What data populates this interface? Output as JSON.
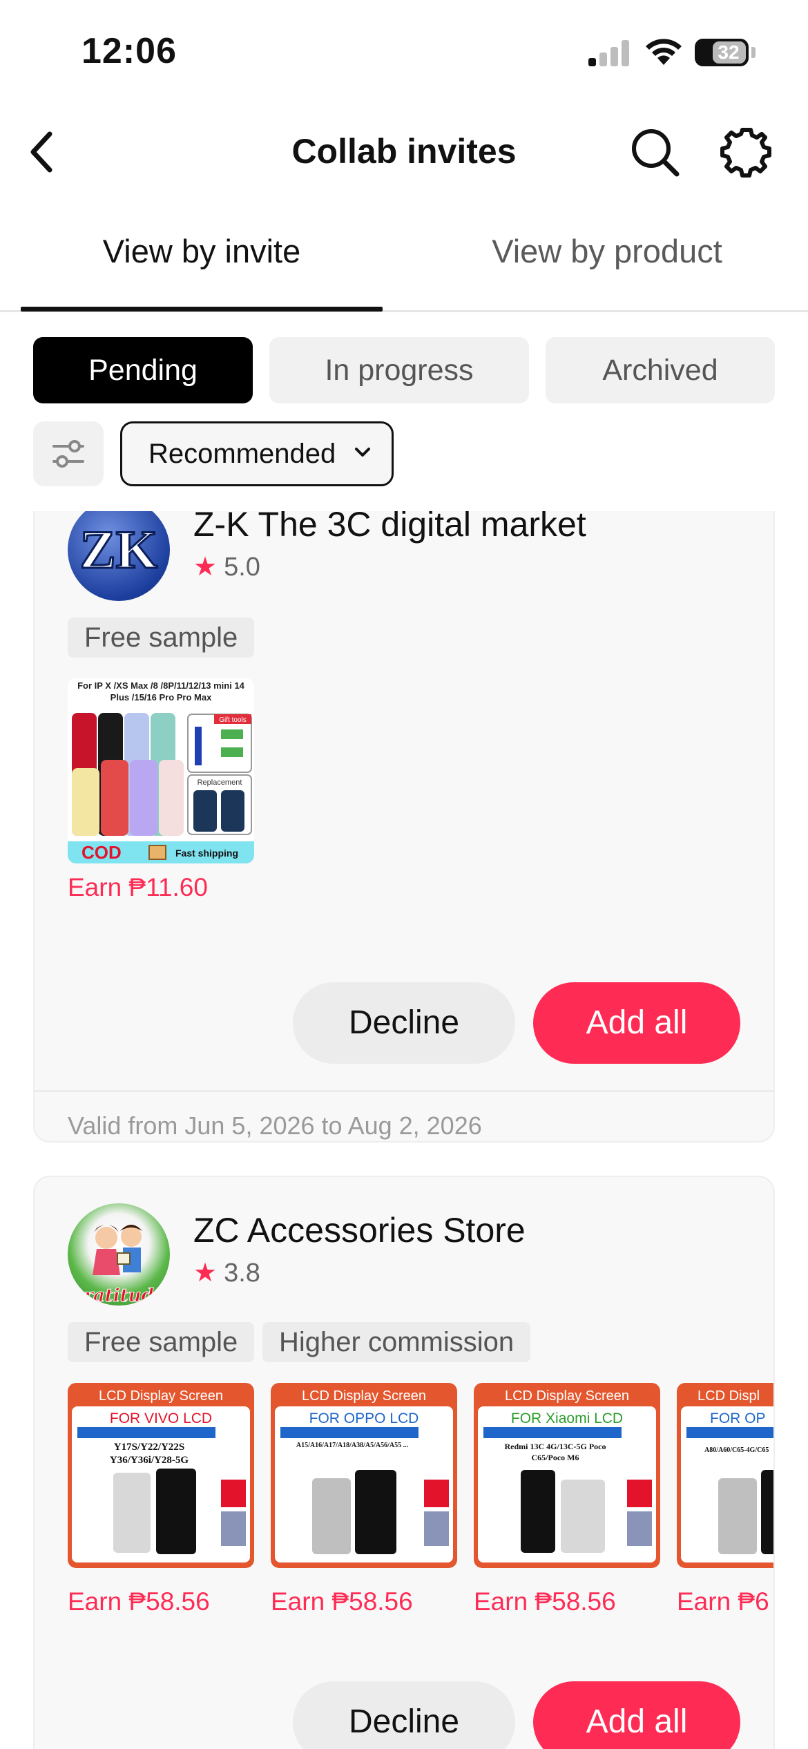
{
  "status_bar": {
    "time": "12:06",
    "battery": "32"
  },
  "nav": {
    "title": "Collab invites"
  },
  "view_tabs": {
    "by_invite": "View by invite",
    "by_product": "View by product"
  },
  "status_filter": {
    "pending": "Pending",
    "in_progress": "In progress",
    "archived": "Archived",
    "selected": "Pending"
  },
  "sort": {
    "label": "Recommended"
  },
  "invites": [
    {
      "store": "Z-K The 3C digital market",
      "logo_text": "ZK",
      "rating": "5.0",
      "tags": [
        "Free sample"
      ],
      "products": [
        {
          "title": "For IP X /XS Max /8 /8P/11/12/13 mini 14 Plus /15/16 Pro Pro Max",
          "badge": "Gift tools",
          "replacement": "Replacement",
          "cod": "COD",
          "shipping": "Fast shipping",
          "earn": "Earn ₱11.60"
        }
      ],
      "decline": "Decline",
      "add_all": "Add all",
      "valid": "Valid from Jun 5, 2026 to Aug 2, 2026"
    },
    {
      "store": "ZC Accessories Store",
      "logo_text": "ratitud",
      "rating": "3.8",
      "tags": [
        "Free sample",
        "Higher commission"
      ],
      "products": [
        {
          "header": "LCD Display Screen",
          "brand": "FOR VIVO LCD",
          "models": "Y17S/Y22/Y22S Y36/Y36i/Y28-5G",
          "earn": "Earn ₱58.56"
        },
        {
          "header": "LCD Display Screen",
          "brand": "FOR OPPO LCD",
          "models": "A15/A16/A17/A18/A38/A5/A56/A55 ...",
          "earn": "Earn ₱58.56"
        },
        {
          "header": "LCD Display Screen",
          "brand": "FOR Xiaomi LCD",
          "models": "Redmi 13C 4G/13C-5G Poco C65/Poco M6",
          "earn": "Earn ₱58.56"
        },
        {
          "header": "LCD Displ",
          "brand": "FOR OP",
          "models": "A80/A60/C65-4G/C65",
          "earn": "Earn ₱6"
        }
      ],
      "decline": "Decline",
      "add_all": "Add all"
    }
  ],
  "colors": {
    "accent": "#fe2c55",
    "chip_active": "#000000",
    "chip_bg": "#f1f1f1",
    "card_bg": "#f8f8f8"
  }
}
